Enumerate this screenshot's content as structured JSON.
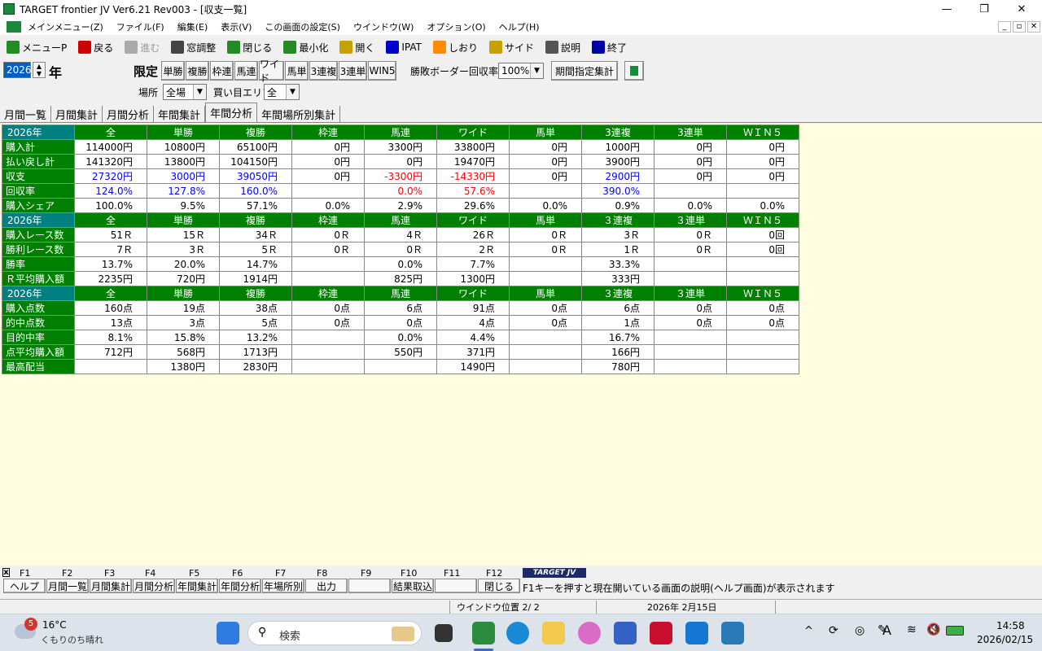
{
  "window": {
    "title": "TARGET frontier JV  Ver6.21  Rev003 - [収支一覧]",
    "min": "—",
    "max": "❐",
    "close": "✕"
  },
  "menu": {
    "items": [
      "メインメニュー(Z)",
      "ファイル(F)",
      "編集(E)",
      "表示(V)",
      "この画面の設定(S)",
      "ウインドウ(W)",
      "オプション(O)",
      "ヘルプ(H)"
    ],
    "mdi_min": "_",
    "mdi_restore": "▫",
    "mdi_close": "✕"
  },
  "toolbar": {
    "items": [
      {
        "label": "メニューP",
        "color": "#228b22"
      },
      {
        "label": "戻る",
        "color": "#cc0000"
      },
      {
        "label": "進む",
        "color": "#aaaaaa"
      },
      {
        "label": "窓調整",
        "color": "#444"
      },
      {
        "label": "閉じる",
        "color": "#228b22"
      },
      {
        "label": "最小化",
        "color": "#228b22"
      },
      {
        "label": "開く",
        "color": "#c8a000"
      },
      {
        "label": "IPAT",
        "color": "#0000cc"
      },
      {
        "label": "しおり",
        "color": "#ff8c00"
      },
      {
        "label": "サイド",
        "color": "#c8a000"
      },
      {
        "label": "説明",
        "color": "#555"
      },
      {
        "label": "終了",
        "color": "#0000aa"
      }
    ]
  },
  "controls": {
    "year": "2026",
    "year_suffix": "年",
    "limit_label": "限定",
    "bet_buttons": [
      "単勝",
      "複勝",
      "枠連",
      "馬連",
      "ワイド",
      "馬単",
      "3連複",
      "3連単",
      "WIN5"
    ],
    "border_label": "勝敗ボーダー回収率",
    "border_value": "100%",
    "period_button": "期間指定集計",
    "place_label": "場所",
    "place_value": "全場",
    "area_label": "買い目エリア",
    "area_value": "全"
  },
  "tabs": [
    "月間一覧",
    "月間集計",
    "月間分析",
    "年間集計",
    "年間分析",
    "年間場所別集計"
  ],
  "active_tab": 4,
  "sections": [
    {
      "header": [
        "2026年",
        "全",
        "単勝",
        "複勝",
        "枠連",
        "馬連",
        "ワイド",
        "馬単",
        "3連複",
        "3連単",
        "ＷＩＮ５"
      ],
      "rows": [
        {
          "label": "購入計",
          "values": [
            "114000円",
            "10800円",
            "65100円",
            "0円",
            "3300円",
            "33800円",
            "0円",
            "1000円",
            "0円",
            "0円"
          ]
        },
        {
          "label": "払い戻し計",
          "values": [
            "141320円",
            "13800円",
            "104150円",
            "0円",
            "0円",
            "19470円",
            "0円",
            "3900円",
            "0円",
            "0円"
          ]
        },
        {
          "label": "収支",
          "values": [
            "27320円",
            "3000円",
            "39050円",
            "0円",
            "-3300円",
            "-14330円",
            "0円",
            "2900円",
            "0円",
            "0円"
          ],
          "colors": [
            "blue",
            "blue",
            "blue",
            "",
            "red",
            "red",
            "",
            "blue",
            "",
            ""
          ]
        },
        {
          "label": "回収率",
          "values": [
            "124.0%",
            "127.8%",
            "160.0%",
            "",
            "0.0%",
            "57.6%",
            "",
            "390.0%",
            "",
            ""
          ],
          "colors": [
            "blue",
            "blue",
            "blue",
            "",
            "red",
            "red",
            "",
            "blue",
            "",
            ""
          ]
        },
        {
          "label": "購入シェア",
          "values": [
            "100.0%",
            "9.5%",
            "57.1%",
            "0.0%",
            "2.9%",
            "29.6%",
            "0.0%",
            "0.9%",
            "0.0%",
            "0.0%"
          ]
        }
      ]
    },
    {
      "header": [
        "2026年",
        "全",
        "単勝",
        "複勝",
        "枠連",
        "馬連",
        "ワイド",
        "馬単",
        "３連複",
        "３連単",
        "ＷＩＮ５"
      ],
      "rows": [
        {
          "label": "購入レース数",
          "values": [
            "51Ｒ",
            "15Ｒ",
            "34Ｒ",
            "0Ｒ",
            "4Ｒ",
            "26Ｒ",
            "0Ｒ",
            "3Ｒ",
            "0Ｒ",
            "0回"
          ]
        },
        {
          "label": "勝利レース数",
          "values": [
            "7Ｒ",
            "3Ｒ",
            "5Ｒ",
            "0Ｒ",
            "0Ｒ",
            "2Ｒ",
            "0Ｒ",
            "1Ｒ",
            "0Ｒ",
            "0回"
          ]
        },
        {
          "label": "勝率",
          "values": [
            "13.7%",
            "20.0%",
            "14.7%",
            "",
            "0.0%",
            "7.7%",
            "",
            "33.3%",
            "",
            ""
          ]
        },
        {
          "label": "Ｒ平均購入額",
          "values": [
            "2235円",
            "720円",
            "1914円",
            "",
            "825円",
            "1300円",
            "",
            "333円",
            "",
            ""
          ]
        }
      ]
    },
    {
      "header": [
        "2026年",
        "全",
        "単勝",
        "複勝",
        "枠連",
        "馬連",
        "ワイド",
        "馬単",
        "３連複",
        "３連単",
        "ＷＩＮ５"
      ],
      "rows": [
        {
          "label": "購入点数",
          "values": [
            "160点",
            "19点",
            "38点",
            "0点",
            "6点",
            "91点",
            "0点",
            "6点",
            "0点",
            "0点"
          ]
        },
        {
          "label": "的中点数",
          "values": [
            "13点",
            "3点",
            "5点",
            "0点",
            "0点",
            "4点",
            "0点",
            "1点",
            "0点",
            "0点"
          ]
        },
        {
          "label": "目的中率",
          "values": [
            "8.1%",
            "15.8%",
            "13.2%",
            "",
            "0.0%",
            "4.4%",
            "",
            "16.7%",
            "",
            ""
          ]
        },
        {
          "label": "点平均購入額",
          "values": [
            "712円",
            "568円",
            "1713円",
            "",
            "550円",
            "371円",
            "",
            "166円",
            "",
            ""
          ]
        },
        {
          "label": "最高配当",
          "values": [
            "",
            "1380円",
            "2830円",
            "",
            "",
            "1490円",
            "",
            "780円",
            "",
            ""
          ]
        }
      ]
    }
  ],
  "fkeys": {
    "keys": [
      "F1",
      "F2",
      "F3",
      "F4",
      "F5",
      "F6",
      "F7",
      "F8",
      "F9",
      "F10",
      "F11",
      "F12"
    ],
    "labels": [
      "ヘルプ",
      "月間一覧",
      "月間集計",
      "月間分析",
      "年間集計",
      "年間分析",
      "年場所別",
      "出力",
      "",
      "結果取込",
      "",
      "閉じる"
    ],
    "logo": "TARGET JV",
    "x_mark": "x",
    "hint": "F1キーを押すと現在開いている画面の説明(ヘルプ画面)が表示されます"
  },
  "status": {
    "window_pos": "ウインドウ位置 2/ 2",
    "date": "2026年 2月15日"
  },
  "taskbar": {
    "weather_badge": "5",
    "temp": "16°C",
    "forecast": "くもりのち晴れ",
    "search": "検索",
    "time": "14:58",
    "date": "2026/02/15",
    "ime": "A"
  }
}
